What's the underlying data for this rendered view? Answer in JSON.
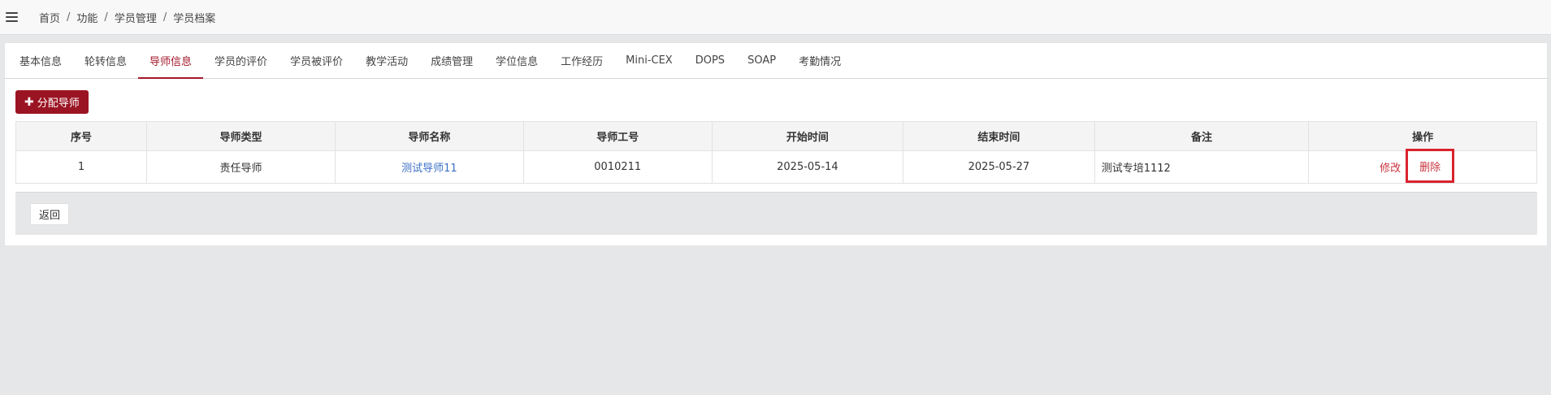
{
  "breadcrumb": [
    "首页",
    "功能",
    "学员管理",
    "学员档案"
  ],
  "tabs": [
    "基本信息",
    "轮转信息",
    "导师信息",
    "学员的评价",
    "学员被评价",
    "教学活动",
    "成绩管理",
    "学位信息",
    "工作经历",
    "Mini-CEX",
    "DOPS",
    "SOAP",
    "考勤情况"
  ],
  "active_tab": "导师信息",
  "toolbar": {
    "assign_label": "分配导师",
    "assign_icon": "plus-icon"
  },
  "table": {
    "headers": [
      "序号",
      "导师类型",
      "导师名称",
      "导师工号",
      "开始时间",
      "结束时间",
      "备注",
      "操作"
    ],
    "rows": [
      {
        "index": "1",
        "type": "责任导师",
        "name": "测试导师11",
        "code": "0010211",
        "start": "2025-05-14",
        "end": "2025-05-27",
        "note": "测试专培1112",
        "edit_label": "修改",
        "delete_label": "删除"
      }
    ]
  },
  "footer": {
    "back_label": "返回"
  },
  "colors": {
    "brand": "#9b1423",
    "accent": "#a3182a",
    "link": "#3a6fc6",
    "highlight": "#d9232d"
  }
}
